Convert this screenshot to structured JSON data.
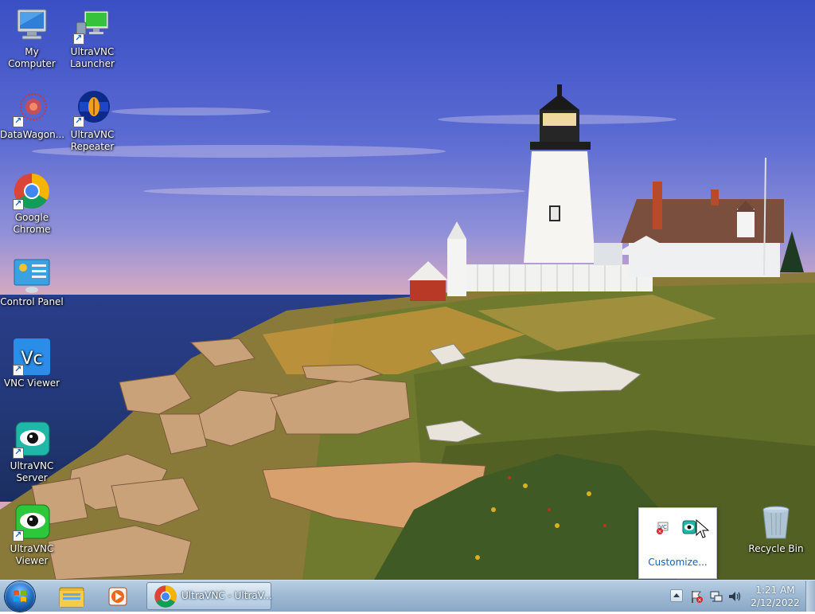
{
  "desktop": {
    "icons": [
      {
        "label_line1": "My Computer",
        "label_line2": "",
        "icon": "computer-icon"
      },
      {
        "label_line1": "UltraVNC",
        "label_line2": "Launcher",
        "icon": "ultravnc-launcher-icon"
      },
      {
        "label_line1": "DataWagon...",
        "label_line2": "",
        "icon": "datawagon-icon"
      },
      {
        "label_line1": "UltraVNC",
        "label_line2": "Repeater",
        "icon": "ultravnc-repeater-icon"
      },
      {
        "label_line1": "Google",
        "label_line2": "Chrome",
        "icon": "chrome-icon"
      },
      {
        "label_line1": "Control Panel",
        "label_line2": "",
        "icon": "control-panel-icon"
      },
      {
        "label_line1": "VNC Viewer",
        "label_line2": "",
        "icon": "vnc-viewer-icon"
      },
      {
        "label_line1": "UltraVNC",
        "label_line2": "Server",
        "icon": "ultravnc-server-icon"
      },
      {
        "label_line1": "UltraVNC",
        "label_line2": "Viewer",
        "icon": "ultravnc-viewer-icon"
      },
      {
        "label_line1": "Recycle Bin",
        "label_line2": "",
        "icon": "recycle-bin-icon"
      }
    ]
  },
  "tray_popup": {
    "icons": [
      "network-error-icon",
      "ultravnc-tray-icon"
    ],
    "customize_label": "Customize..."
  },
  "taskbar": {
    "pinned": [
      "windows-explorer-icon",
      "media-player-icon"
    ],
    "active_task_label": "UltraVNC - UltraV...",
    "tray_icons": [
      "show-hidden-icons-arrow",
      "action-center-flag-icon",
      "network-icon",
      "volume-icon"
    ],
    "clock_time": "1:21 AM",
    "clock_date": "2/12/2022"
  },
  "colors": {
    "taskbar": "#9fbad4",
    "link": "#1a5fb4",
    "sky": "#3a4fc4"
  }
}
